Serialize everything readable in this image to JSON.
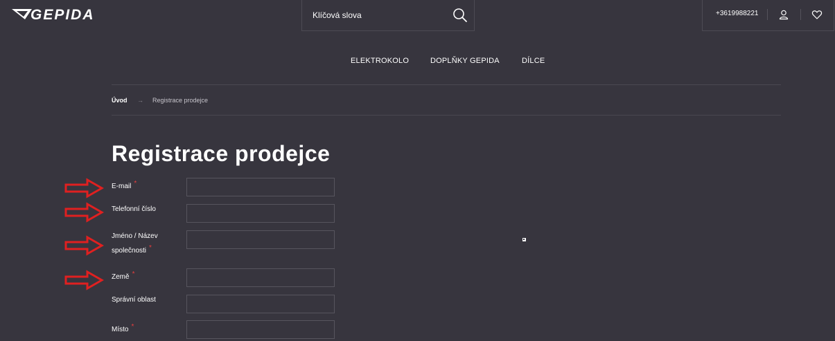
{
  "brand": {
    "logo_text": "GEPIDA"
  },
  "search": {
    "placeholder": "Klíčová slova"
  },
  "header": {
    "phone": "+3619988221"
  },
  "nav": {
    "items": [
      "ELEKTROKOLO",
      "DOPLŇKY GEPIDA",
      "DÍLCE"
    ]
  },
  "breadcrumb": {
    "home": "Úvod",
    "separator": "→",
    "current": "Registrace prodejce"
  },
  "page": {
    "title": "Registrace prodejce"
  },
  "form": {
    "fields": [
      {
        "label": "E-mail",
        "required": true,
        "value": ""
      },
      {
        "label": "Telefonní číslo",
        "required": false,
        "value": ""
      },
      {
        "label_line1": "Jméno / Název",
        "label_line2": "společnosti",
        "required": true,
        "value": ""
      },
      {
        "label": "Země",
        "required": true,
        "value": ""
      },
      {
        "label": "Správní oblast",
        "required": false,
        "value": ""
      },
      {
        "label": "Místo",
        "required": true,
        "value": ""
      }
    ],
    "required_mark": "*"
  },
  "colors": {
    "background": "#37353e",
    "text": "#ffffff",
    "required": "#e83e3e",
    "annotation_arrow": "#e02020"
  },
  "icons": {
    "search": "search-icon",
    "user": "user-icon",
    "wishlist": "heart-icon",
    "annotation": "arrow-right-icon"
  }
}
